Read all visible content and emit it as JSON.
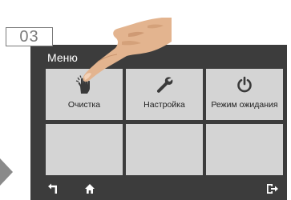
{
  "step": {
    "number": "03"
  },
  "screen": {
    "title": "Меню",
    "tiles": [
      {
        "label": "Очистка",
        "icon": "cleaning-hand-icon"
      },
      {
        "label": "Настройка",
        "icon": "wrench-icon"
      },
      {
        "label": "Режим ожидания",
        "icon": "power-icon"
      },
      {
        "label": "",
        "icon": ""
      },
      {
        "label": "",
        "icon": ""
      },
      {
        "label": "",
        "icon": ""
      }
    ],
    "nav": {
      "back_icon": "back-arrow-icon",
      "home_icon": "home-icon",
      "exit_icon": "exit-icon"
    }
  },
  "colors": {
    "screen_bg": "#3c3c3c",
    "tile_bg": "#d4d4d4",
    "icon_color": "#3a3a3a",
    "badge_border": "#7a7a7a",
    "arrow_color": "#8a8a8a",
    "hand_skin": "#e3b48f"
  }
}
